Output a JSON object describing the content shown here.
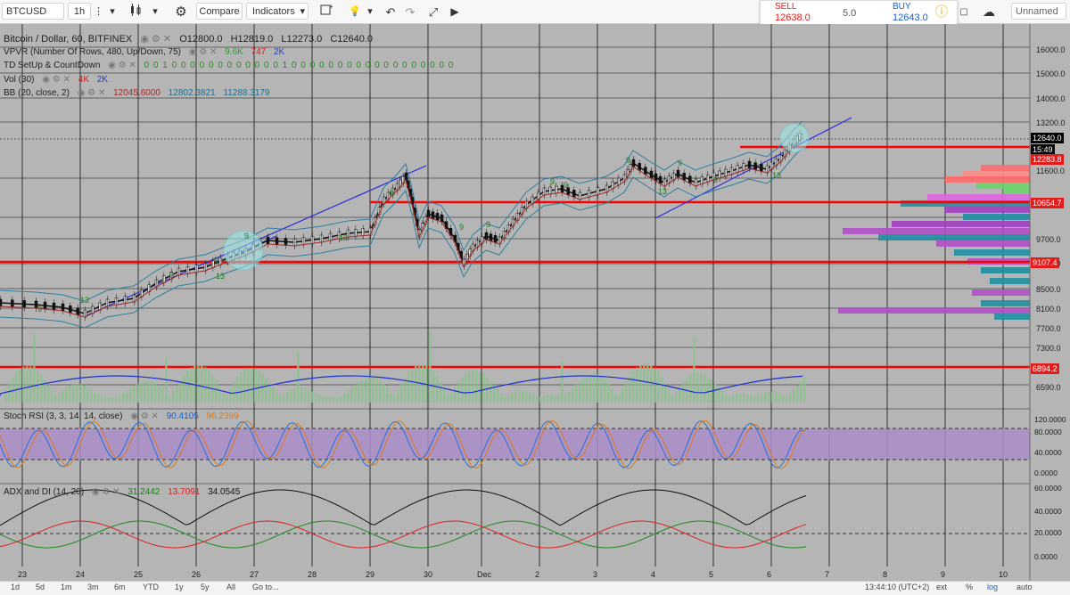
{
  "toolbar": {
    "symbol": "BTCUSD",
    "interval": "1h",
    "compare": "Compare",
    "indicators": "Indicators",
    "unnamed": "Unnamed"
  },
  "trade": {
    "sell_label": "SELL",
    "sell_value": "12638.0",
    "spread": "5.0",
    "buy_label": "BUY",
    "buy_value": "12643.0"
  },
  "legend": {
    "main": {
      "title": "Bitcoin / Dollar, 60, BITFINEX",
      "o": "O12800.0",
      "h": "H12819.0",
      "l": "L12273.0",
      "c": "C12640.0"
    },
    "vpvr": {
      "name": "VPVR (Number Of Rows, 480, Up/Down, 75)",
      "v1": "9.6K",
      "v2": "747",
      "v3": "2K"
    },
    "td": {
      "name": "TD SetUp & CountDown",
      "values": "0 0 1 0 0 0 0 0 0 0 0 0 0 0 0 1 0 0 0 0 0 0 0 0 0 0 0 0 0 0 0 0 0 0"
    },
    "vol": {
      "name": "Vol (30)",
      "v1": "4K",
      "v2": "2K"
    },
    "bb": {
      "name": "BB (20, close, 2)",
      "v1": "12045.6000",
      "v2": "12802.3821",
      "v3": "11288.3179"
    },
    "stoch": {
      "name": "Stoch RSI (3, 3, 14, 14, close)",
      "v1": "90.4105",
      "v2": "96.2399"
    },
    "adx": {
      "name": "ADX and DI (14, 20)",
      "v1": "31.2442",
      "v2": "13.7091",
      "v3": "34.0545"
    }
  },
  "price_axis": [
    "16000.0",
    "15000.0",
    "14000.0",
    "13200.0",
    "11600.0",
    "9700.0",
    "9100.0",
    "8500.0",
    "8100.0",
    "7700.0",
    "7300.0",
    "6590.0"
  ],
  "price_tags": [
    {
      "label": "12640.0",
      "color": "#000000"
    },
    {
      "label": "15:49",
      "color": "#000000"
    },
    {
      "label": "12283.8",
      "color": "#e31b1b"
    },
    {
      "label": "10654.7",
      "color": "#e31b1b"
    },
    {
      "label": "9107.4",
      "color": "#e31b1b"
    },
    {
      "label": "6894.2",
      "color": "#e31b1b"
    }
  ],
  "stoch_axis": [
    "120.0000",
    "80.0000",
    "40.0000",
    "0.0000"
  ],
  "adx_axis": [
    "60.0000",
    "40.0000",
    "20.0000",
    "0.0000"
  ],
  "time_axis": [
    "23",
    "24",
    "25",
    "26",
    "27",
    "28",
    "29",
    "30",
    "Dec",
    "2",
    "3",
    "4",
    "5",
    "6",
    "7",
    "8",
    "9",
    "10"
  ],
  "td_labels": [
    "9",
    "13",
    "9",
    "9",
    "13",
    "9",
    "13",
    "9",
    "9",
    "9",
    "9",
    "9",
    "9",
    "13",
    "9",
    "9",
    "13"
  ],
  "bottom": {
    "ranges": [
      "1d",
      "5d",
      "1m",
      "3m",
      "6m",
      "YTD",
      "1y",
      "5y",
      "All",
      "Go to..."
    ],
    "clock": "13:44:10 (UTC+2)",
    "right": [
      "ext",
      "%",
      "log",
      "auto"
    ]
  },
  "colors": {
    "bg": "#b5b5b5",
    "red_line": "#ff0000",
    "trend": "#2a2adf",
    "rsi_band": "#a98dc9",
    "bb": "#2e7fa0",
    "ma": "#a52a2a"
  }
}
